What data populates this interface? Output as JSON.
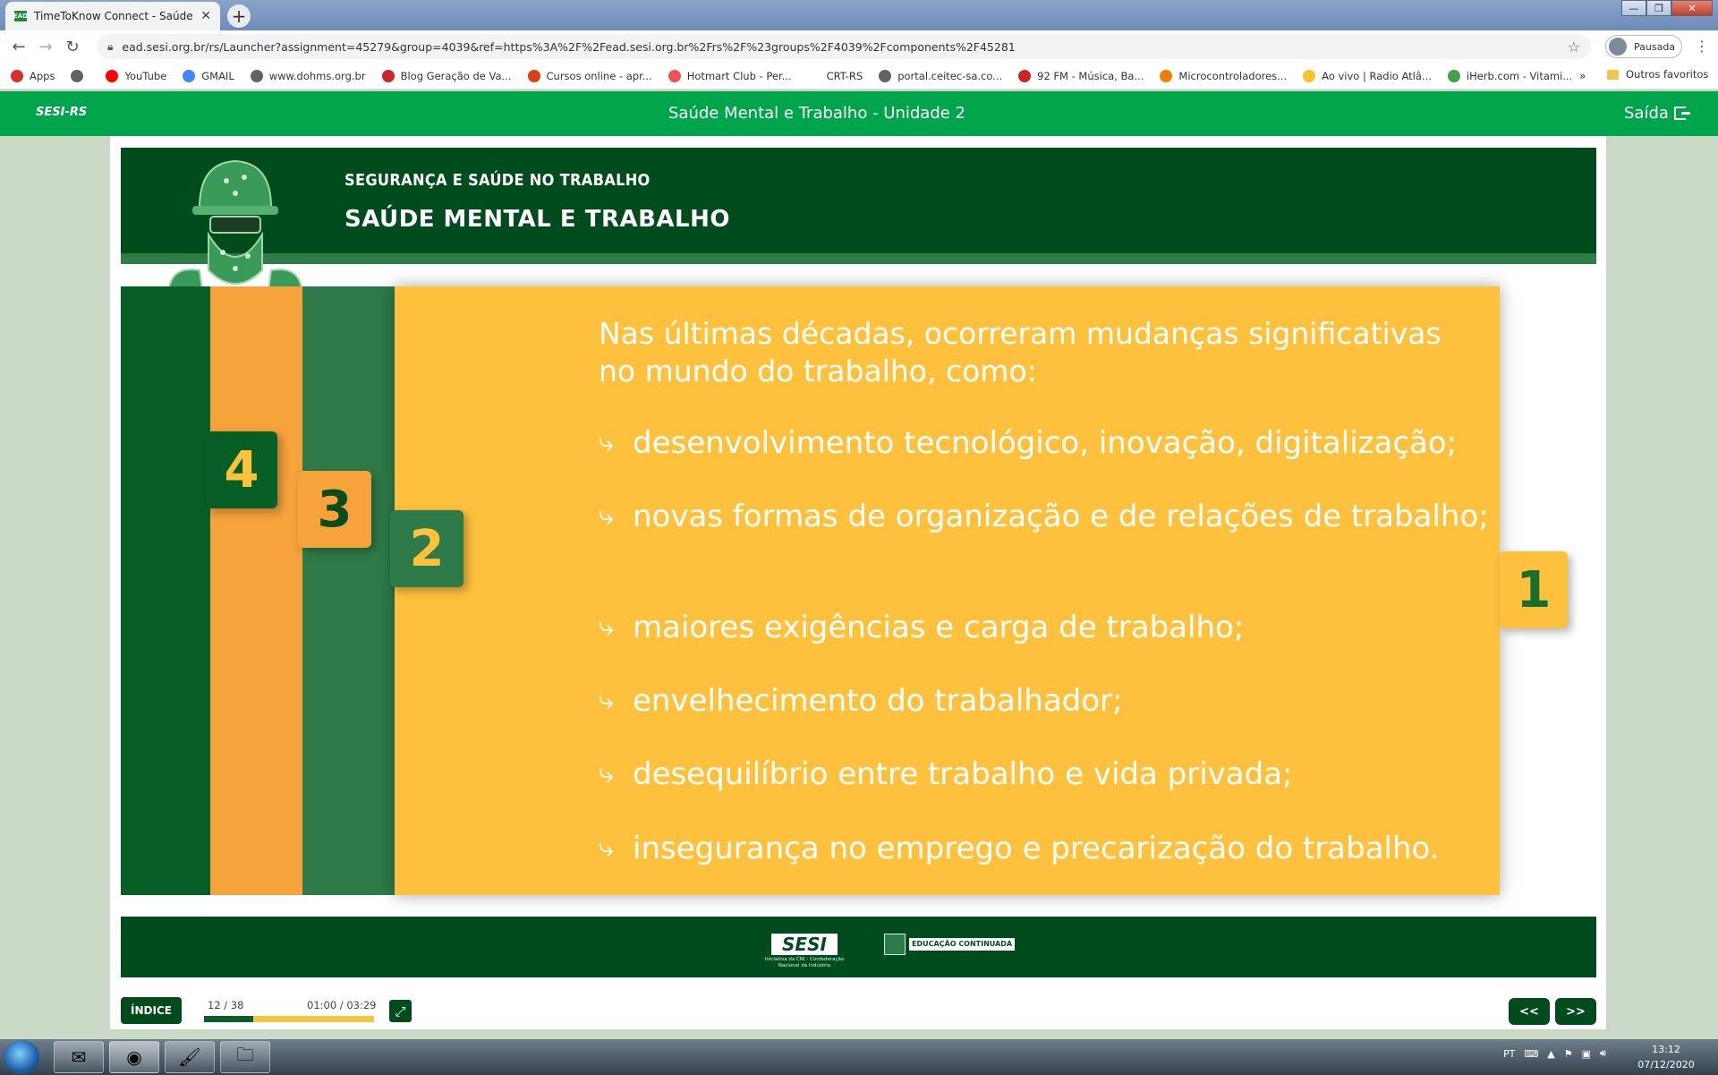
{
  "browser": {
    "tab_title": "TimeToKnow Connect - Saúde M",
    "tab_favicon": "EAD",
    "url": "ead.sesi.org.br/rs/Launcher?assignment=45279&group=4039&ref=https%3A%2F%2Fead.sesi.org.br%2Frs%2F%23groups%2F4039%2Fcomponents%2F45281",
    "profile_label": "Pausada",
    "bookmarks": [
      {
        "label": "Apps",
        "icon": "apps-grid-icon",
        "color": "#d93025"
      },
      {
        "label": "",
        "icon": "globe-icon",
        "color": "#5f6368"
      },
      {
        "label": "YouTube",
        "icon": "youtube-icon",
        "color": "#ff0000"
      },
      {
        "label": "GMAIL",
        "icon": "google-icon",
        "color": "#4285f4"
      },
      {
        "label": "www.dohms.org.br",
        "icon": "globe-icon",
        "color": "#5f6368"
      },
      {
        "label": "Blog Geração de Va...",
        "icon": "blog-icon",
        "color": "#c62828"
      },
      {
        "label": "Cursos online - apr...",
        "icon": "hotmart-icon",
        "color": "#d84315"
      },
      {
        "label": "Hotmart Club - Per...",
        "icon": "flame-icon",
        "color": "#ef5350"
      },
      {
        "label": "CRT-RS",
        "icon": "blank-icon",
        "color": "#ffffff"
      },
      {
        "label": "portal.ceitec-sa.co...",
        "icon": "globe-icon",
        "color": "#5f6368"
      },
      {
        "label": "92 FM - Música, Ba...",
        "icon": "radio-92-icon",
        "color": "#c62828"
      },
      {
        "label": "Microcontroladores...",
        "icon": "blogger-icon",
        "color": "#f57c00"
      },
      {
        "label": "Ao vivo | Radio Atlâ...",
        "icon": "radio-icon",
        "color": "#fbc02d"
      },
      {
        "label": "iHerb.com - Vitami...",
        "icon": "leaf-icon",
        "color": "#43a047"
      }
    ],
    "more_label": "»",
    "other_favorites": "Outros favoritos"
  },
  "app": {
    "logo": "SESI-RS",
    "title": "Saúde Mental e Trabalho - Unidade 2",
    "exit_label": "Saída"
  },
  "slide": {
    "kicker": "SEGURANÇA E SAÚDE NO TRABALHO",
    "headline": "SAÚDE MENTAL E TRABALHO",
    "intro": "Nas últimas décadas, ocorreram mudanças significativas no mundo do trabalho, como:",
    "items": [
      "desenvolvimento tecnológico, inovação, digitalização;",
      "novas formas de organização e de relações de trabalho;",
      "maiores exigências e carga de trabalho;",
      "envelhecimento do trabalhador;",
      "desequilíbrio entre trabalho e vida privada;",
      "insegurança no emprego e precarização do trabalho."
    ],
    "tabs": [
      "4",
      "3",
      "2",
      "1"
    ],
    "footer_logo": "SESI",
    "footer_logo_sub": "Iniciativa da CNI - Confederação Nacional da Indústria",
    "footer_edu": "EDUCAÇÃO CONTINUADA",
    "colors": {
      "dark_green": "#004c1c",
      "mid_green": "#2e7b49",
      "orange": "#f6a33c",
      "yellow": "#fdc13d",
      "brand_green": "#00a44a"
    }
  },
  "player": {
    "index_label": "ÍNDICE",
    "slide_counter": "12 / 38",
    "time": "01:00 / 03:29",
    "progress_fraction": 0.29,
    "prev_label": "<<",
    "next_label": ">>"
  },
  "taskbar": {
    "apps": [
      "outlook-icon",
      "chrome-icon",
      "paint-icon",
      "file-explorer-icon"
    ],
    "lang": "PT",
    "time": "13:12",
    "date": "07/12/2020"
  }
}
